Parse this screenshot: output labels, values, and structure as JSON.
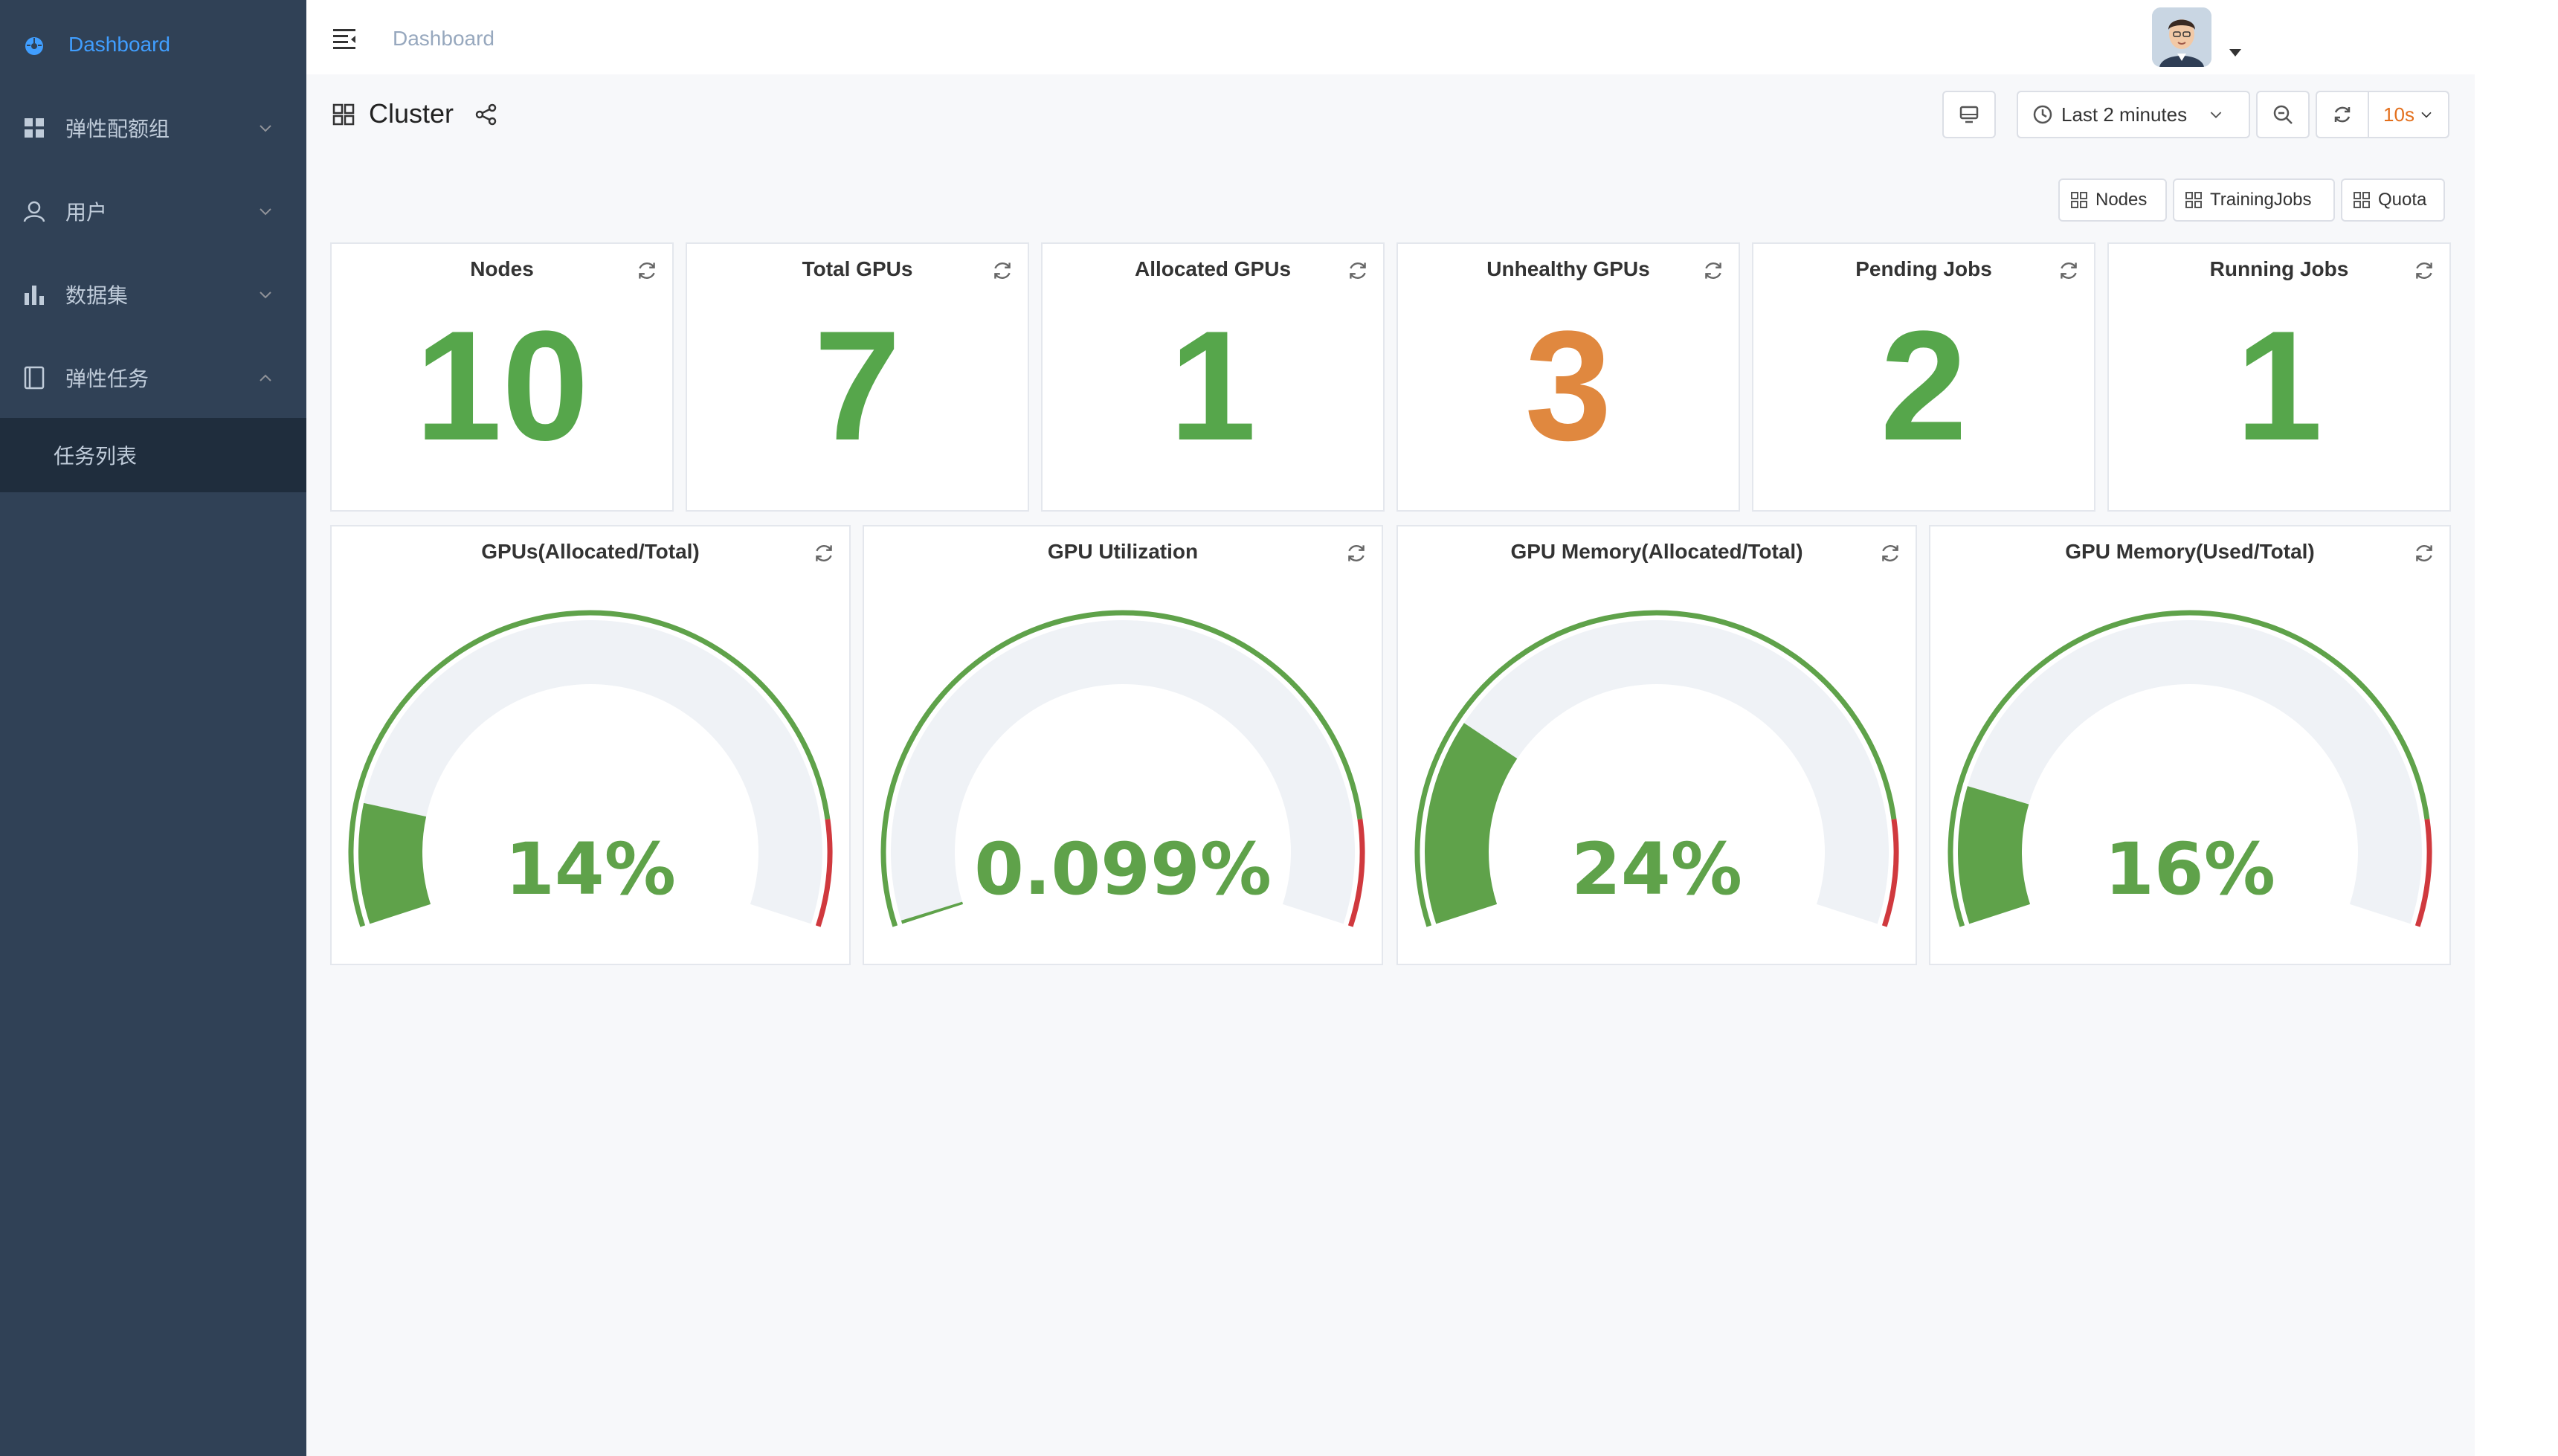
{
  "sidebar": {
    "items": [
      {
        "label": "Dashboard",
        "icon": "dashboard-icon",
        "active": true
      },
      {
        "label": "弹性配额组",
        "icon": "grid-icon"
      },
      {
        "label": "用户",
        "icon": "user-icon"
      },
      {
        "label": "数据集",
        "icon": "bar-chart-icon"
      },
      {
        "label": "弹性任务",
        "icon": "tablet-icon",
        "expanded": true
      }
    ],
    "submenu": [
      {
        "label": "任务列表"
      }
    ]
  },
  "topbar": {
    "breadcrumb": "Dashboard"
  },
  "dashboard": {
    "title": "Cluster",
    "time_range": "Last 2 minutes",
    "refresh_interval": "10s",
    "links": [
      "Nodes",
      "TrainingJobs",
      "Quota"
    ]
  },
  "stats": [
    {
      "title": "Nodes",
      "value": "10",
      "color": "#56a64b"
    },
    {
      "title": "Total GPUs",
      "value": "7",
      "color": "#56a64b"
    },
    {
      "title": "Allocated GPUs",
      "value": "1",
      "color": "#56a64b"
    },
    {
      "title": "Unhealthy GPUs",
      "value": "3",
      "color": "#e0883f"
    },
    {
      "title": "Pending Jobs",
      "value": "2",
      "color": "#56a64b"
    },
    {
      "title": "Running Jobs",
      "value": "1",
      "color": "#56a64b"
    }
  ],
  "gauges": [
    {
      "title": "GPUs(Allocated/Total)",
      "display": "14%",
      "value": 0.14
    },
    {
      "title": "GPU Utilization",
      "display": "0.099%",
      "value": 0.00099
    },
    {
      "title": "GPU Memory(Allocated/Total)",
      "display": "24%",
      "value": 0.24
    },
    {
      "title": "GPU Memory(Used/Total)",
      "display": "16%",
      "value": 0.16
    }
  ],
  "colors": {
    "green": "#56a64b",
    "gauge_fill": "#5fa24a",
    "red_threshold": "#d0393e",
    "gauge_track": "#eff2f6",
    "accent": "#409eff"
  }
}
